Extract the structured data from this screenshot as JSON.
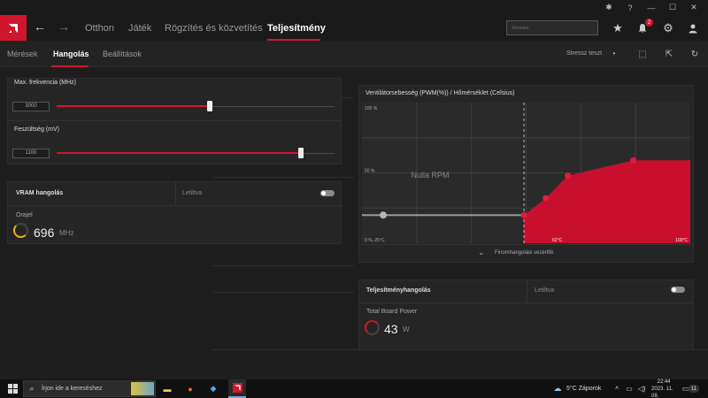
{
  "window": {
    "controls": [
      "bug-icon",
      "help-icon",
      "minimize-icon",
      "maximize-icon",
      "close-icon"
    ]
  },
  "nav": {
    "tabs": [
      {
        "label": "Otthon"
      },
      {
        "label": "Játék"
      },
      {
        "label": "Rögzítés és közvetítés"
      },
      {
        "label": "Teljesítmény"
      }
    ],
    "search_placeholder": "Keresés",
    "notification_count": "2"
  },
  "subnav": {
    "tabs": [
      {
        "label": "Mérések"
      },
      {
        "label": "Hangolás"
      },
      {
        "label": "Beállítások"
      }
    ],
    "stress_test": "Stressz teszt"
  },
  "tuning": {
    "max_freq_label": "Max. frekvencia (MHz)",
    "max_freq_value": "3000",
    "max_freq_fraction": 0.55,
    "voltage_label": "Feszültség (mV)",
    "voltage_value": "1100",
    "voltage_fraction": 0.88
  },
  "vram": {
    "title": "VRAM hangolás",
    "state": "Letiltva",
    "clock_label": "Órajel",
    "clock_value": "696",
    "clock_unit": "MHz"
  },
  "fan": {
    "title": "Ventilátorsebesség (PWM(%)) / Hőmérséklet (Celsius)",
    "y_top": "100 %",
    "y_mid": "50 %",
    "y_bottom": "0 %, 25°C",
    "x_mid": "62°C",
    "x_end": "100°C",
    "zero_rpm": "Nulla RPM",
    "fine_tune": "Finomhangolási vezérlők"
  },
  "chart_data": {
    "type": "area",
    "title": "Ventilátorsebesség (PWM(%)) / Hőmérséklet (Celsius)",
    "xlabel": "",
    "ylabel": "",
    "xlim": [
      25,
      100
    ],
    "ylim": [
      0,
      100
    ],
    "x": [
      62,
      67,
      72,
      87,
      100
    ],
    "values": [
      20,
      32,
      48,
      59,
      59
    ],
    "zero_rpm_threshold_x": 62,
    "grid": true
  },
  "power": {
    "title": "Teljesítményhangolás",
    "state": "Letiltva",
    "tbp_label": "Total Board Power",
    "tbp_value": "43",
    "tbp_unit": "W"
  },
  "taskbar": {
    "search_placeholder": "Írjon ide a kereséshez",
    "weather": "5°C  Záporok",
    "time": "22:44",
    "date": "2023. 11. 08.",
    "notif_count": "11"
  },
  "colors": {
    "accent": "#d0162c",
    "gauge_vram": "#e8b21a",
    "gauge_power": "#d0162c"
  }
}
